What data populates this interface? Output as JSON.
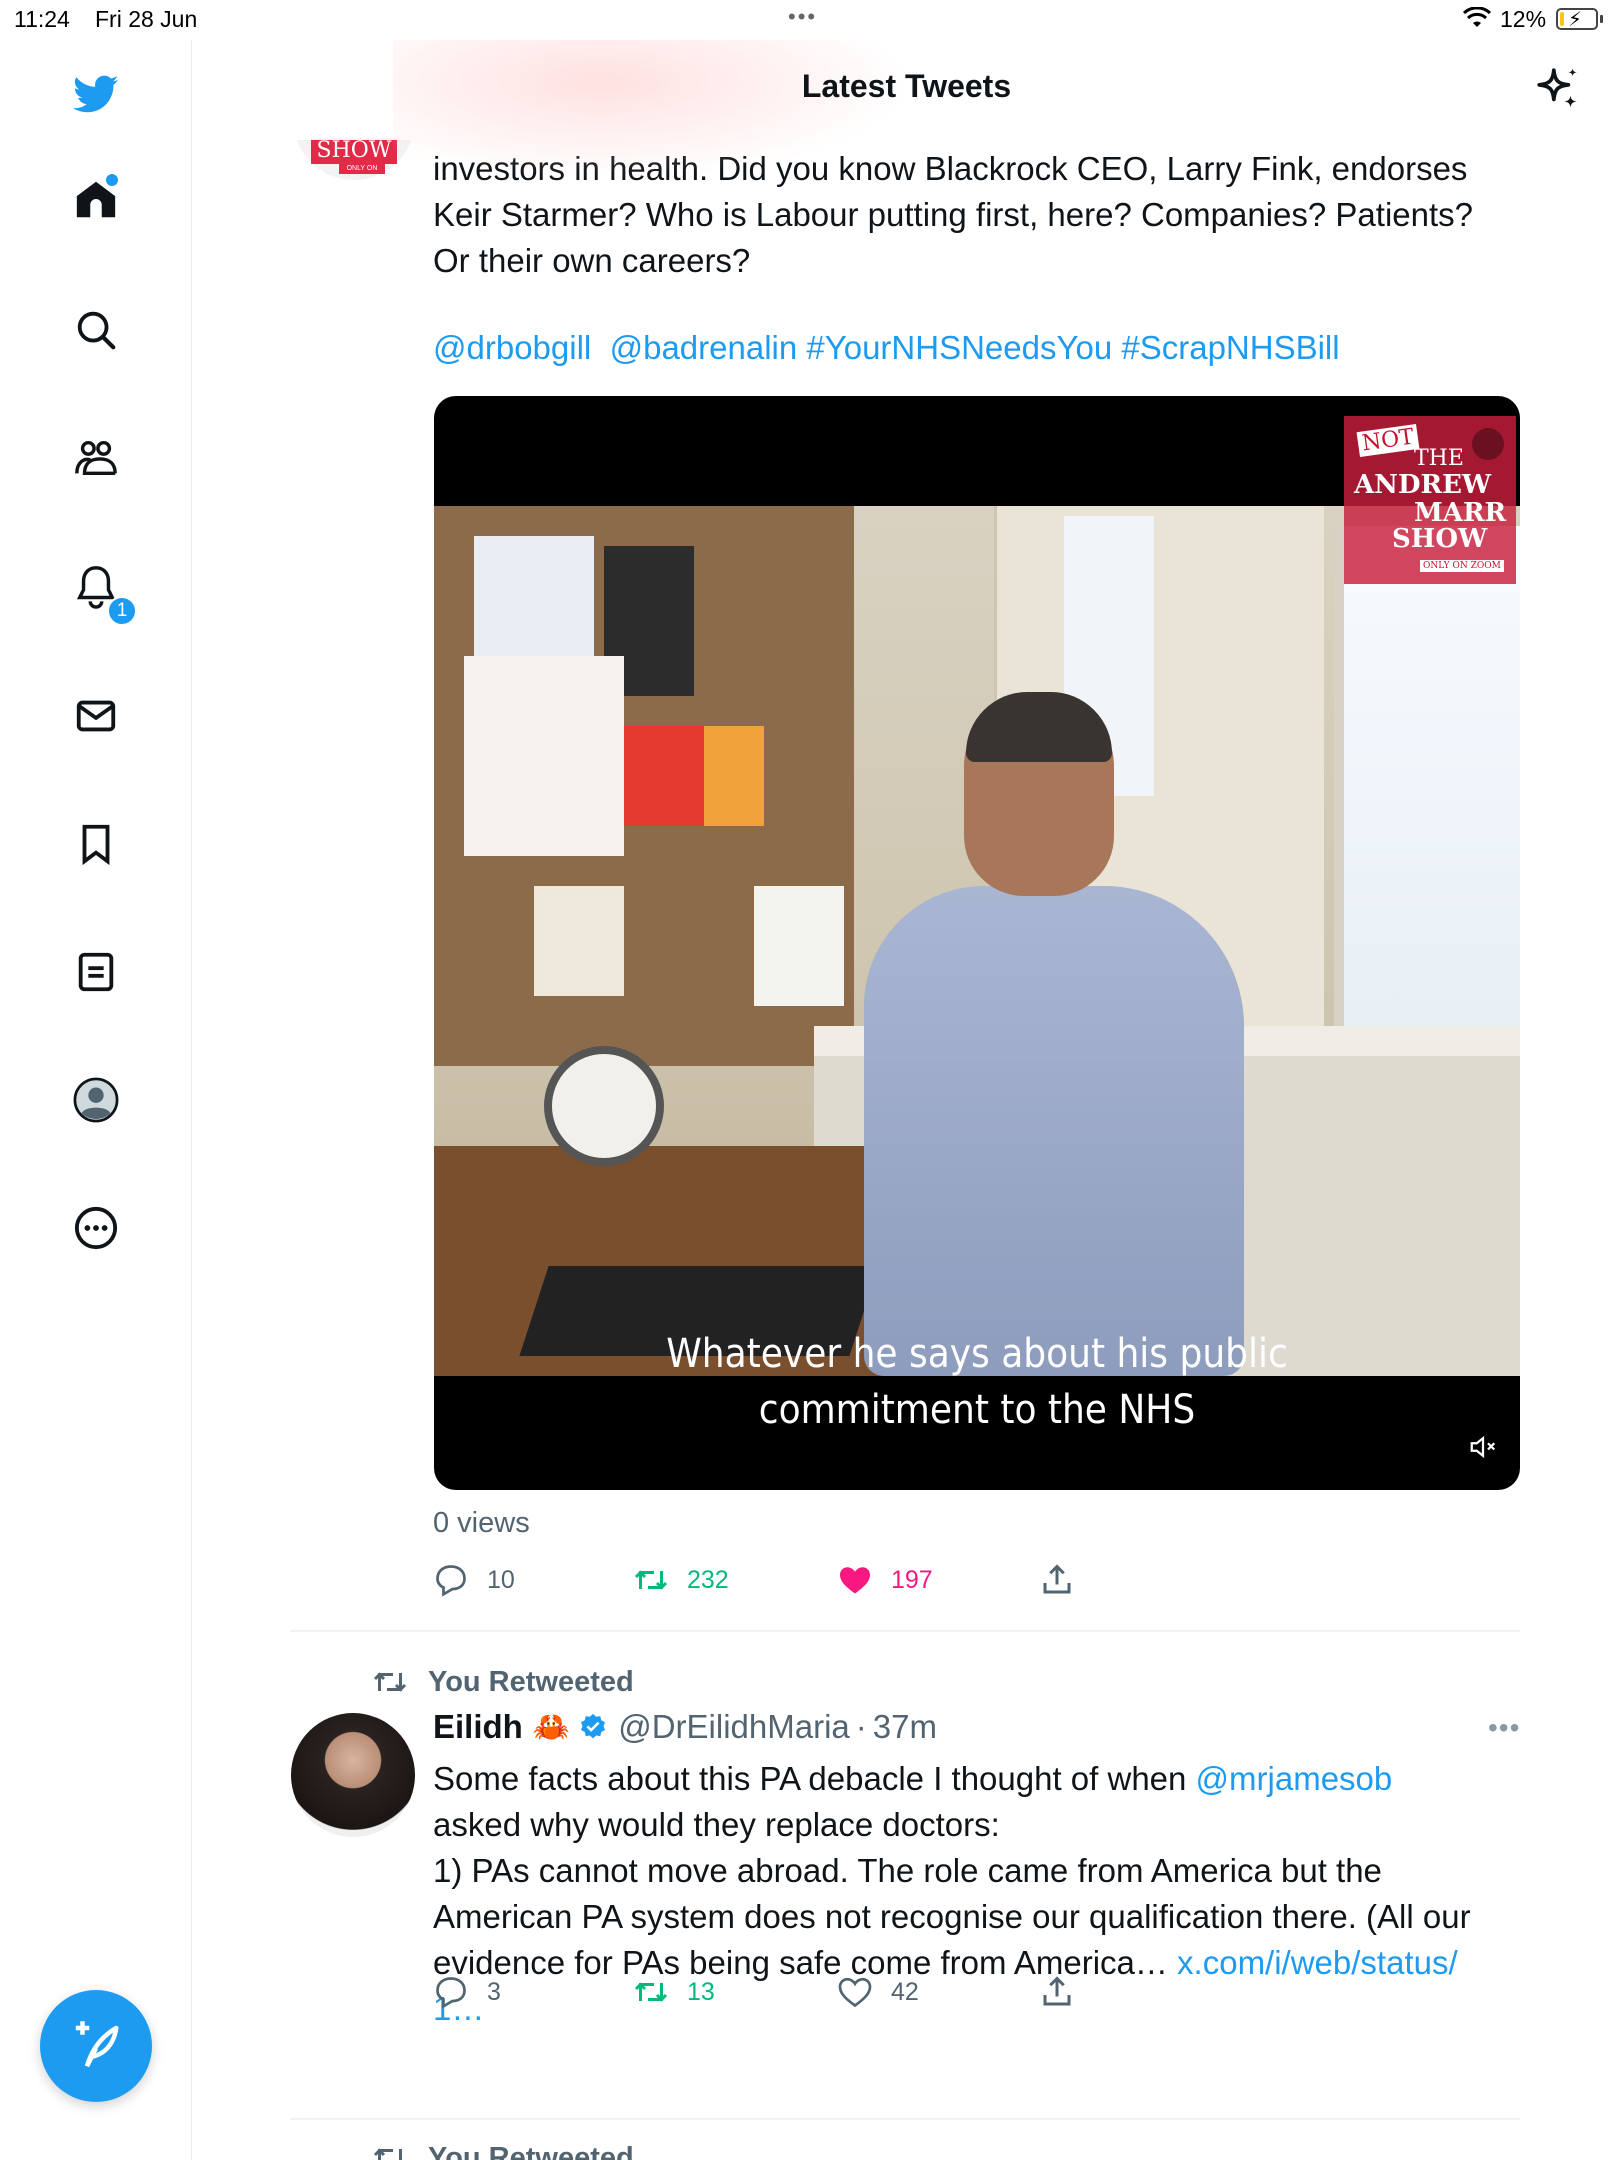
{
  "status_bar": {
    "time": "11:24",
    "date": "Fri 28 Jun",
    "battery_pct": "12%",
    "battery_level": 0.12
  },
  "sidebar": {
    "items": [
      {
        "name": "home",
        "icon": "home-icon"
      },
      {
        "name": "explore",
        "icon": "search-icon"
      },
      {
        "name": "communities",
        "icon": "people-icon"
      },
      {
        "name": "notifications",
        "icon": "bell-icon",
        "badge": "1"
      },
      {
        "name": "messages",
        "icon": "mail-icon"
      },
      {
        "name": "bookmarks",
        "icon": "bookmark-icon"
      },
      {
        "name": "lists",
        "icon": "list-icon"
      },
      {
        "name": "profile",
        "icon": "avatar-icon"
      },
      {
        "name": "more",
        "icon": "more-icon"
      }
    ],
    "compose_icon": "compose-tweet-icon"
  },
  "header": {
    "title": "Latest Tweets",
    "sparkle_icon": "sparkle-icon"
  },
  "tweet1": {
    "avatar_label": "SHOW",
    "avatar_sub": "ONLY ON",
    "text_lines": [
      "investors in health. Did you know Blackrock CEO, Larry Fink, endorses",
      "Keir Starmer? Who is Labour putting first, here? Companies? Patients?",
      "Or their own careers?"
    ],
    "mentions": [
      "@drbobgill",
      "@badrenalin"
    ],
    "hashtags": [
      "#YourNHSNeedsYou",
      "#ScrapNHSBill"
    ],
    "video": {
      "caption_line1": "Whatever he says about his public",
      "caption_line2": "commitment to the NHS",
      "logo_not": "NOT",
      "logo_the": "THE",
      "logo_andrew": "ANDREW",
      "logo_marr": "MARR",
      "logo_show": "SHOW",
      "logo_only": "ONLY ON ZOOM",
      "mute_icon": "muted-speaker-icon"
    },
    "views": "0 views",
    "actions": {
      "replies": "10",
      "retweets": "232",
      "likes": "197"
    }
  },
  "tweet2": {
    "retweet_label": "You Retweeted",
    "name": "Eilidh",
    "emoji": "🦀",
    "handle": "@DrEilidhMaria",
    "separator": "·",
    "time": "37m",
    "text_before_mention": "Some facts about this PA debacle I thought of when ",
    "mention": "@mrjamesob",
    "text_lines": [
      "asked why would they replace doctors:",
      "1) PAs cannot move abroad. The role came from America but the",
      "American PA system does not recognise our qualification there. (All our"
    ],
    "text_last_before_link": "evidence for PAs being safe come from America… ",
    "link": "x.com/i/web/status/",
    "link_cont": "1…",
    "actions": {
      "replies": "3",
      "retweets": "13",
      "likes": "42"
    }
  },
  "tweet3": {
    "retweet_label": "You Retweeted"
  },
  "colors": {
    "accent": "#1d9bf0",
    "retweet": "#00ba7c",
    "like": "#f91880",
    "muted": "#536471"
  }
}
